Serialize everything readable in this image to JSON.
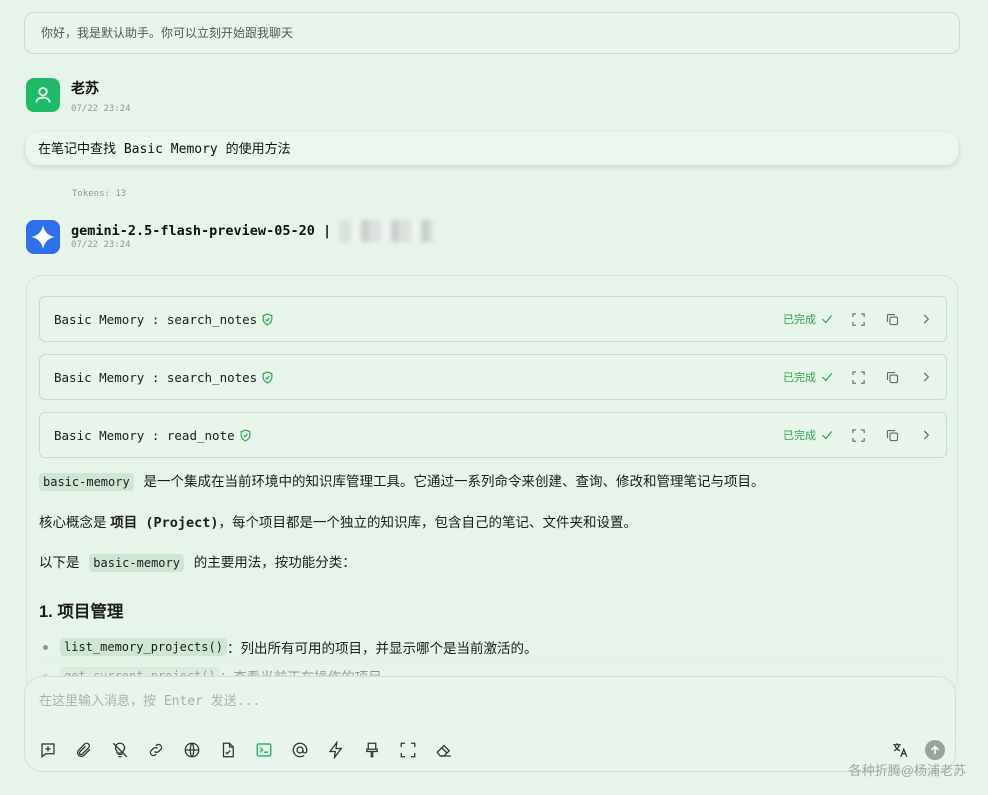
{
  "greeting": "你好，我是默认助手。你可以立刻开始跟我聊天",
  "user_message": {
    "name": "老苏",
    "time": "07/22 23:24",
    "text": "在笔记中查找 Basic Memory 的使用方法",
    "tokens": "Tokens: 13"
  },
  "assistant": {
    "model": "gemini-2.5-flash-preview-05-20 |",
    "time": "07/22 23:24"
  },
  "tool_calls": [
    {
      "name": "Basic Memory : search_notes",
      "status": "已完成"
    },
    {
      "name": "Basic Memory : search_notes",
      "status": "已完成"
    },
    {
      "name": "Basic Memory : read_note",
      "status": "已完成"
    }
  ],
  "content": {
    "p1_code": "basic-memory",
    "p1_text": "是一个集成在当前环境中的知识库管理工具。它通过一系列命令来创建、查询、修改和管理笔记与项目。",
    "p2_pre": "核心概念是 ",
    "p2_bold": "项目 (Project)",
    "p2_post": "，每个项目都是一个独立的知识库，包含自己的笔记、文件夹和设置。",
    "p3_pre": "以下是",
    "p3_code": "basic-memory",
    "p3_post": "的主要用法，按功能分类：",
    "heading": "1. 项目管理",
    "bullets": [
      {
        "code": "list_memory_projects()",
        "text": "：列出所有可用的项目，并显示哪个是当前激活的。"
      },
      {
        "code": "get_current_project()",
        "text": "：查看当前正在操作的项目。"
      }
    ]
  },
  "input": {
    "placeholder": "在这里输入消息，按 Enter 发送..."
  },
  "toolbar_icons": [
    "new-topic-icon",
    "attachment-icon",
    "web-search-off-icon",
    "link-icon",
    "globe-icon",
    "file-icon",
    "terminal-icon",
    "mention-icon",
    "lightning-icon",
    "brush-icon",
    "fullscreen-icon",
    "eraser-icon"
  ],
  "watermark": "各种折腾@杨浦老苏",
  "colors": {
    "accent": "#2ea44f",
    "user_avatar": "#1fb96a",
    "bot_avatar": "#2f6fed"
  }
}
